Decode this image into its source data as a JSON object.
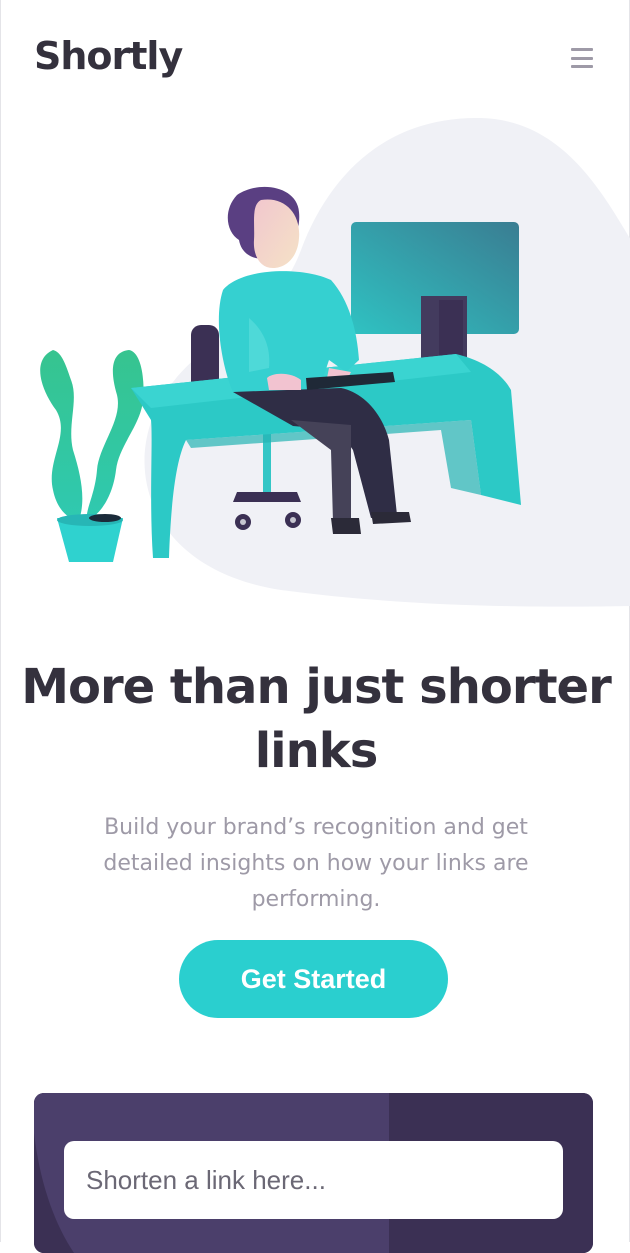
{
  "header": {
    "logo_text": "Shortly",
    "menu_icon": "hamburger-menu-icon"
  },
  "hero": {
    "illustration": "person-working-at-desk-illustration",
    "headline": "More than just shorter links",
    "subtext": "Build your brand’s recognition and get detailed insights on how your links are performing.",
    "cta_label": "Get Started"
  },
  "shorten": {
    "input_placeholder": "Shorten a link here...",
    "input_value": ""
  },
  "colors": {
    "cyan": "#2acfcf",
    "dark_violet": "#3b3054",
    "very_dark_blue": "#34313d",
    "grayish_violet": "#9e9aa7",
    "blob": "#f0f1f6"
  }
}
